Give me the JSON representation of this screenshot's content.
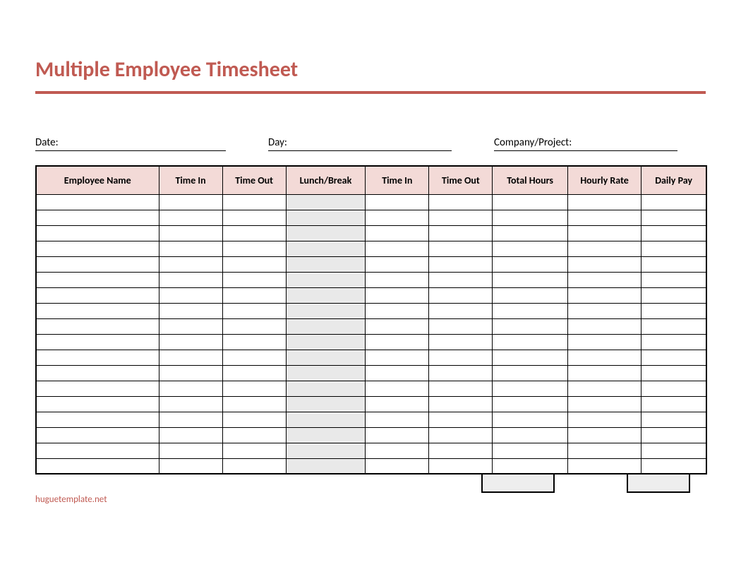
{
  "title": "Multiple Employee Timesheet",
  "meta": {
    "date_label": "Date:",
    "day_label": "Day:",
    "company_label": "Company/Project:"
  },
  "columns": {
    "name": "Employee Name",
    "time_in_1": "Time In",
    "time_out_1": "Time Out",
    "break": "Lunch/Break",
    "time_in_2": "Time In",
    "time_out_2": "Time Out",
    "total_hours": "Total Hours",
    "hourly_rate": "Hourly Rate",
    "daily_pay": "Daily Pay"
  },
  "row_count": 18,
  "footer": "huguetemplate.net"
}
